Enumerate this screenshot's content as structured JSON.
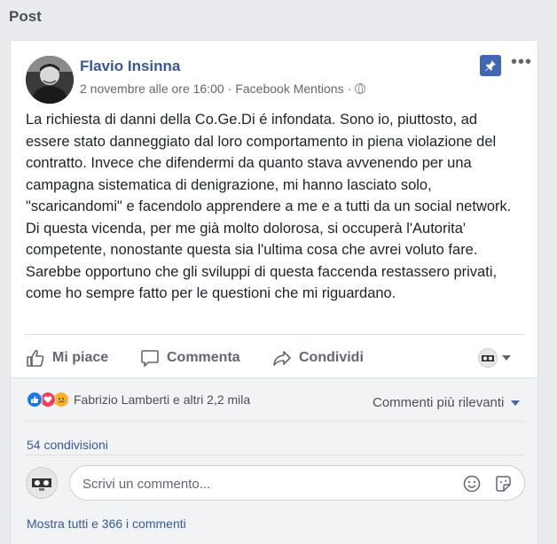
{
  "section": {
    "title": "Post"
  },
  "post": {
    "author": "Flavio Insinna",
    "date": "2 novembre alle ore 16:00",
    "separator": "·",
    "source": "Facebook Mentions",
    "separator2": "·",
    "paragraphs": [
      "La richiesta di danni della Co.Ge.Di é infondata. Sono io, piuttosto, ad essere stato danneggiato dal loro comportamento in piena violazione del contratto. Invece che difendermi da quanto stava avvenendo per una campagna sistematica di denigrazione, mi hanno lasciato solo, \"scaricandomi\" e facendolo apprendere a me e a tutti da un social network. Di questa vicenda, per me già molto dolorosa, si occuperà l'Autorita' competente, nonostante questa sia l'ultima cosa che avrei voluto fare.",
      "Sarebbe opportuno che gli sviluppi di questa faccenda restassero privati, come ho sempre fatto per le questioni che mi riguardano."
    ]
  },
  "actions": {
    "like": "Mi piace",
    "comment": "Commenta",
    "share": "Condividi"
  },
  "reactions": {
    "summary": "Fabrizio Lamberti e altri 2,2 mila",
    "sort_label": "Commenti più rilevanti"
  },
  "shares": "54 condivisioni",
  "comment_input": {
    "placeholder": "Scrivi un commento..."
  },
  "show_all_comments": "Mostra tutti e 366 i commenti",
  "colors": {
    "link_blue": "#365899",
    "pin_blue": "#4267b2",
    "like_blue": "#1877f2",
    "love_red": "#f33e58",
    "sad_yellow": "#f7b125"
  },
  "icons": [
    "pin-icon",
    "more-icon",
    "like-icon",
    "comment-icon",
    "share-icon",
    "globe-icon",
    "emoji-icon",
    "sticker-icon",
    "caret-down-icon"
  ]
}
